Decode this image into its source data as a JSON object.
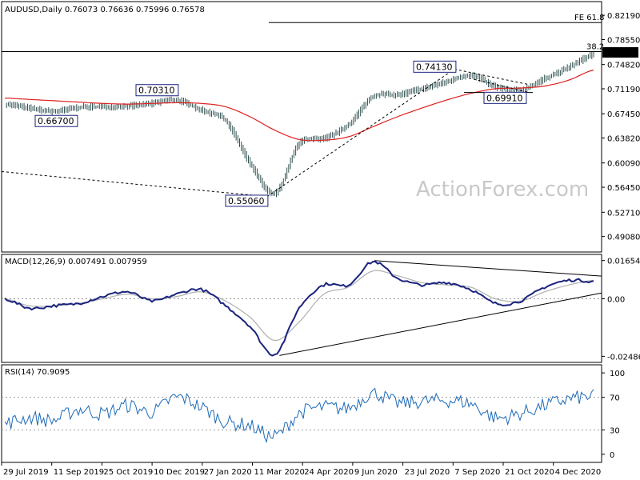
{
  "header": {
    "symbol": "AUDUSD,Daily",
    "ohlc": "0.76073 0.76636 0.75996 0.76578"
  },
  "watermark": "ActionForex.com",
  "chart_data": [
    {
      "type": "line",
      "panel": "price",
      "title": "AUDUSD,Daily 0.76073 0.76636 0.75996 0.76578",
      "y_ticks": [
        "0.82190",
        "0.78550",
        "0.74820",
        "0.71190",
        "0.67450",
        "0.63820",
        "0.60090",
        "0.56450",
        "0.52710",
        "0.49080"
      ],
      "ylim": [
        0.47,
        0.84
      ],
      "last_price": "0.76578",
      "x": [
        "29 Jul 2019",
        "Aug 2019",
        "11 Sep 2019",
        "Oct 2019",
        "25 Oct 2019",
        "Nov 2019",
        "10 Dec 2019",
        "Jan 2020",
        "27 Jan 2020",
        "Feb 2020",
        "11 Mar 2020",
        "24 Mar 2020",
        "Apr 2020",
        "24 Apr 2020",
        "May 2020",
        "9 Jun 2020",
        "Jul 2020",
        "23 Jul 2020",
        "Aug 2020",
        "7 Sep 2020",
        "Oct 2020",
        "21 Oct 2020",
        "Nov 2020",
        "4 Dec 2020",
        "Dec 2020"
      ],
      "series": [
        {
          "values": [
            0.689,
            0.683,
            0.678,
            0.684,
            0.685,
            0.686,
            0.69,
            0.695,
            0.68,
            0.664,
            0.6,
            0.555,
            0.63,
            0.637,
            0.658,
            0.7,
            0.703,
            0.712,
            0.722,
            0.732,
            0.715,
            0.71,
            0.727,
            0.744,
            0.764
          ]
        },
        {
          "values": [
            0.698,
            0.696,
            0.694,
            0.692,
            0.69,
            0.689,
            0.69,
            0.691,
            0.69,
            0.685,
            0.67,
            0.65,
            0.636,
            0.635,
            0.64,
            0.655,
            0.67,
            0.683,
            0.695,
            0.705,
            0.712,
            0.713,
            0.716,
            0.725,
            0.74
          ]
        }
      ],
      "annotations": [
        {
          "label": "FE 61.8",
          "value": 0.811
        },
        {
          "label": "38.2",
          "value": 0.7675
        },
        {
          "label": "0.70310",
          "value": 0.7031
        },
        {
          "label": "0.66700",
          "value": 0.667
        },
        {
          "label": "0.55060",
          "value": 0.5506
        },
        {
          "label": "0.74130",
          "value": 0.7413
        },
        {
          "label": "0.69910",
          "value": 0.6991
        }
      ]
    },
    {
      "type": "line",
      "panel": "macd",
      "title": "MACD(12,26,9) 0.007491 0.007959",
      "y_ticks": [
        "0.01654",
        "0.00",
        "-0.02486"
      ],
      "ylim": [
        -0.0268,
        0.0185
      ],
      "series": [
        {
          "values": [
            0.0,
            -0.004,
            -0.003,
            -0.002,
            0.001,
            0.003,
            -0.001,
            0.002,
            0.004,
            -0.003,
            -0.012,
            -0.024,
            -0.004,
            0.006,
            0.006,
            0.016,
            0.009,
            0.006,
            0.007,
            0.004,
            -0.002,
            -0.001,
            0.005,
            0.008,
            0.0075
          ]
        },
        {
          "values": [
            0.0,
            -0.003,
            -0.003,
            -0.002,
            0.0,
            0.002,
            0.0,
            0.001,
            0.003,
            -0.001,
            -0.008,
            -0.018,
            -0.01,
            0.002,
            0.005,
            0.012,
            0.01,
            0.007,
            0.006,
            0.005,
            0.0,
            -0.001,
            0.003,
            0.006,
            0.008
          ]
        }
      ]
    },
    {
      "type": "line",
      "panel": "rsi",
      "title": "RSI(14) 70.9095",
      "y_ticks": [
        "100",
        "70",
        "30",
        "0"
      ],
      "ylim": [
        -8,
        108
      ],
      "series": [
        {
          "values": [
            38,
            45,
            42,
            55,
            50,
            60,
            52,
            70,
            58,
            40,
            35,
            22,
            50,
            58,
            57,
            75,
            63,
            65,
            66,
            62,
            45,
            50,
            60,
            68,
            71
          ]
        }
      ]
    }
  ],
  "x_axis_labels": [
    "29 Jul 2019",
    "11 Sep 2019",
    "25 Oct 2019",
    "10 Dec 2019",
    "27 Jan 2020",
    "11 Mar 2020",
    "24 Apr 2020",
    "9 Jun 2020",
    "23 Jul 2020",
    "7 Sep 2020",
    "21 Oct 2020",
    "4 Dec 2020"
  ],
  "colors": {
    "price_bars": "#2f4f4f",
    "sma": "#e02020",
    "macd": "#1a237e",
    "signal": "#b0b0b0",
    "trendline": "#000000",
    "last_price_bg": "#000000",
    "label_border": "#1a237e"
  }
}
